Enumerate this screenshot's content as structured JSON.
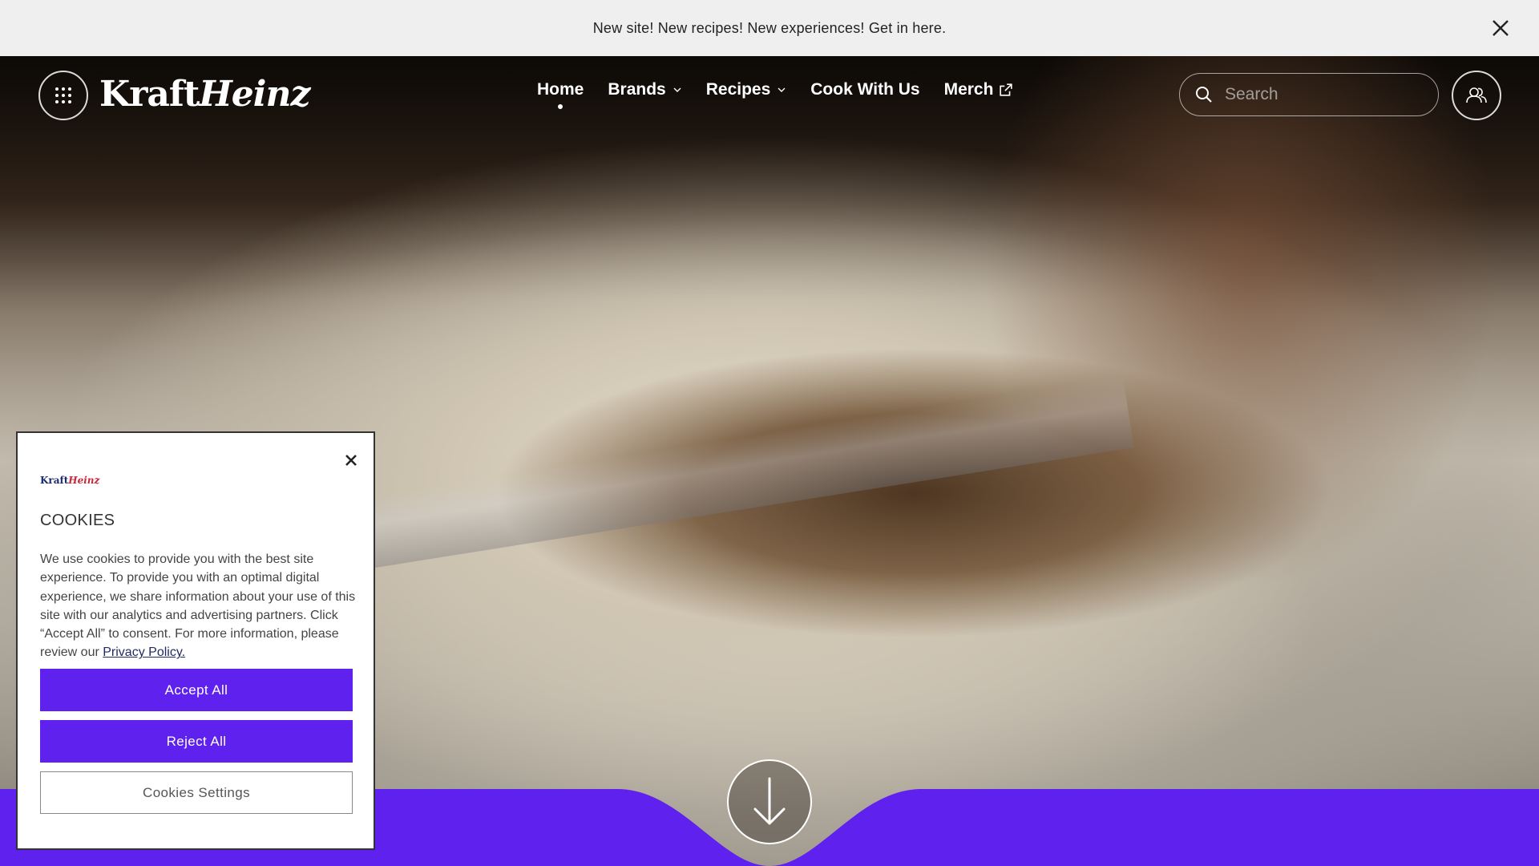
{
  "announcement": {
    "text": "New site! New recipes! New experiences! Get in here.",
    "close_icon": "close-icon"
  },
  "header": {
    "logo_part1": "Kraft",
    "logo_part2": "Heinz",
    "menu_icon": "grid-icon",
    "nav": [
      {
        "label": "Home",
        "active": true
      },
      {
        "label": "Brands",
        "icon": "chevron-down-icon"
      },
      {
        "label": "Recipes",
        "icon": "chevron-down-icon"
      },
      {
        "label": "Cook With Us"
      },
      {
        "label": "Merch",
        "icon": "external-link-icon"
      }
    ],
    "search": {
      "placeholder": "Search",
      "value": "",
      "icon": "search-icon"
    },
    "account_icon": "users-icon"
  },
  "hero": {
    "scroll_icon": "arrow-down-icon"
  },
  "cookie_modal": {
    "logo_part1": "Kraft",
    "logo_part2": "Heinz",
    "title": "COOKIES",
    "body": "We use cookies to provide you with the best site experience. To provide you with an optimal digital experience, we share information about your use of this site with our analytics and advertising partners. Click “Accept All” to consent. For more information, please review our ",
    "privacy_link": "Privacy Policy.",
    "accept_label": "Accept All",
    "reject_label": "Reject All",
    "settings_label": "Cookies Settings"
  },
  "colors": {
    "accent": "#5f21ee",
    "announcement_bg": "#efefef"
  }
}
